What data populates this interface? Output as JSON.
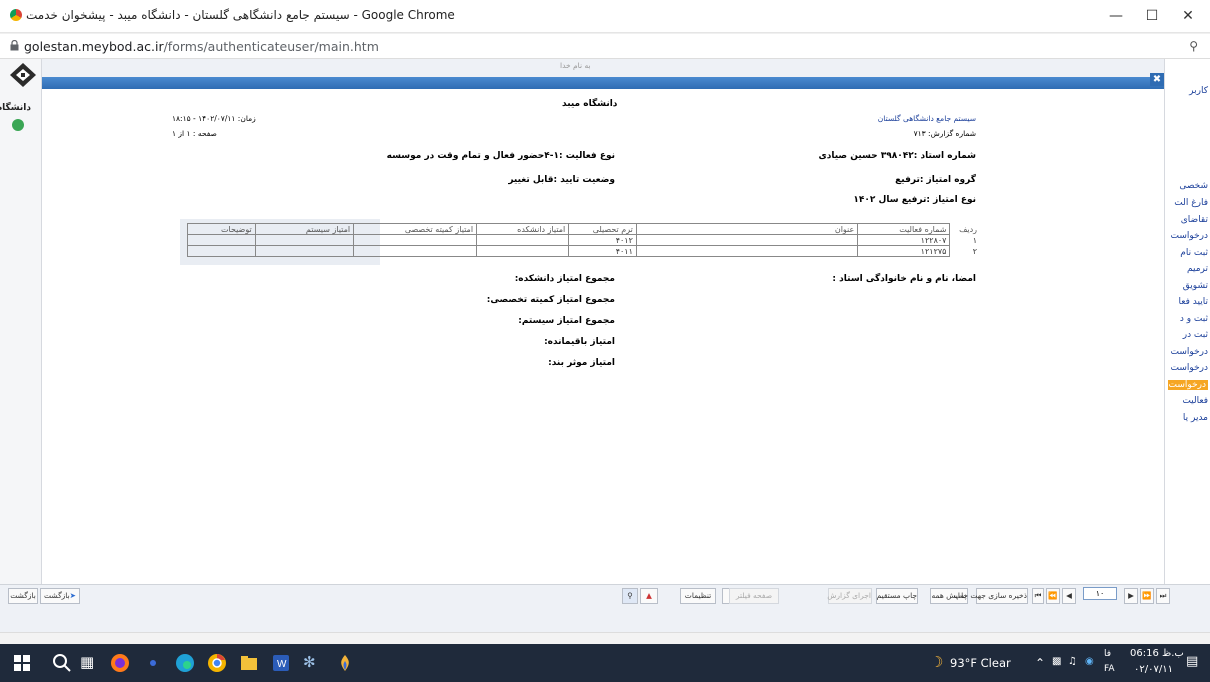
{
  "window": {
    "title": "سیستم جامع دانشگاهی گلستان - دانشگاه میبد - پیشخوان خدمت - Google Chrome",
    "url_host": "golestan.meybod.ac.ir",
    "url_path": "/forms/authenticateuser/main.htm"
  },
  "top_banner": "به نام خدا",
  "left_logo_text": "دانشگاه میبد",
  "right_panel": {
    "user_label": "کاربر",
    "items": [
      "کاربر",
      "شخصی",
      "فارغ الت",
      "تقاضای",
      "درخواست",
      "ثبت نام",
      "ترمیم",
      "تشویق",
      "تایید فعا",
      "ثبت و د",
      "ثبت در",
      "درخواست",
      "درخواست",
      "درخواست",
      "فعالیت",
      "مدیر یا"
    ]
  },
  "report": {
    "university": "دانشگاه میبد",
    "system_name": "سیستم جامع دانشگاهی گلستان",
    "report_number": "شماره گزارش: ۷۱۳",
    "datetime": "زمان: ۱۴۰۲/۰۷/۱۱ - ۱۸:۱۵",
    "page": "صفحه : ۱ از ۱",
    "professor": "شماره استاد :۳۹۸۰۴۲ حسین صیادی",
    "activity_type": "نوع فعالیت :۱-۴حضور فعال و تمام وقت در موسسه",
    "score_group": "گروه امتیاز :ترفیع",
    "approval_status": "وضعیت تایید :قابل تغییر",
    "score_type": "نوع امتیاز :ترفیع سال ۱۴۰۲",
    "table": {
      "headers": [
        "ردیف",
        "شماره فعالیت",
        "عنوان",
        "ترم تحصیلی",
        "امتیاز دانشکده",
        "امتیاز کمیته تخصصی",
        "امتیاز سیستم",
        "توضیحات"
      ],
      "rows": [
        [
          "۱",
          "۱۲۲۸۰۷",
          "",
          "۴۰۱۲",
          "",
          "",
          "",
          ""
        ],
        [
          "۲",
          "۱۲۱۲۷۵",
          "",
          "۴۰۱۱",
          "",
          "",
          "",
          ""
        ]
      ]
    },
    "signature": "امضا، نام و نام خانوادگی استاد :",
    "sums": [
      "مجموع امتیاز دانشکده:",
      "مجموع امتیاز کمیته تخصصی:",
      "مجموع امتیاز سیستم:",
      "امتیاز باقیمانده:",
      "امتیاز موثر بند:"
    ]
  },
  "toolbar": {
    "back": "بازگشت",
    "back2": "بازگشت",
    "settings": "تنظیمات",
    "filter": "صفحه فیلتر",
    "run": "اجرای گزارش",
    "print": "چاپ مستقیم",
    "show_all": "نمایش همه",
    "save": "ذخیره سازی جهت چاپ",
    "page_value": "۱۰"
  },
  "taskbar": {
    "weather": "93°F Clear",
    "time": "06:16 ب.ظ",
    "date": "۰۲/۰۷/۱۱",
    "lang": "FA",
    "lang2": "فا"
  }
}
